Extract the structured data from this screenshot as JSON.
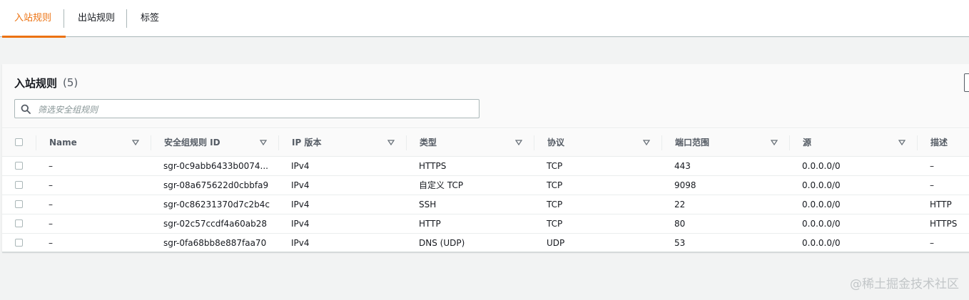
{
  "tabs": [
    {
      "label": "入站规则",
      "active": true
    },
    {
      "label": "出站规则",
      "active": false
    },
    {
      "label": "标签",
      "active": false
    }
  ],
  "panel": {
    "title": "入站规则",
    "count": "(5)"
  },
  "search": {
    "placeholder": "筛选安全组规则",
    "value": ""
  },
  "table": {
    "columns": [
      "Name",
      "安全组规则 ID",
      "IP 版本",
      "类型",
      "协议",
      "端口范围",
      "源",
      "描述"
    ],
    "rows": [
      [
        "–",
        "sgr-0c9abb6433b0074...",
        "IPv4",
        "HTTPS",
        "TCP",
        "443",
        "0.0.0.0/0",
        "–"
      ],
      [
        "–",
        "sgr-08a675622d0cbbfa9",
        "IPv4",
        "自定义 TCP",
        "TCP",
        "9098",
        "0.0.0.0/0",
        "–"
      ],
      [
        "–",
        "sgr-0c86231370d7c2b4c",
        "IPv4",
        "SSH",
        "TCP",
        "22",
        "0.0.0.0/0",
        "HTTP"
      ],
      [
        "–",
        "sgr-02c57ccdf4a60ab28",
        "IPv4",
        "HTTP",
        "TCP",
        "80",
        "0.0.0.0/0",
        "HTTPS"
      ],
      [
        "–",
        "sgr-0fa68bb8e887faa70",
        "IPv4",
        "DNS (UDP)",
        "UDP",
        "53",
        "0.0.0.0/0",
        "–"
      ]
    ]
  },
  "watermark": "@稀土掘金技术社区",
  "colors": {
    "accent": "#ec7211",
    "text": "#16191f",
    "muted": "#545b64",
    "border": "#aab7b8"
  }
}
